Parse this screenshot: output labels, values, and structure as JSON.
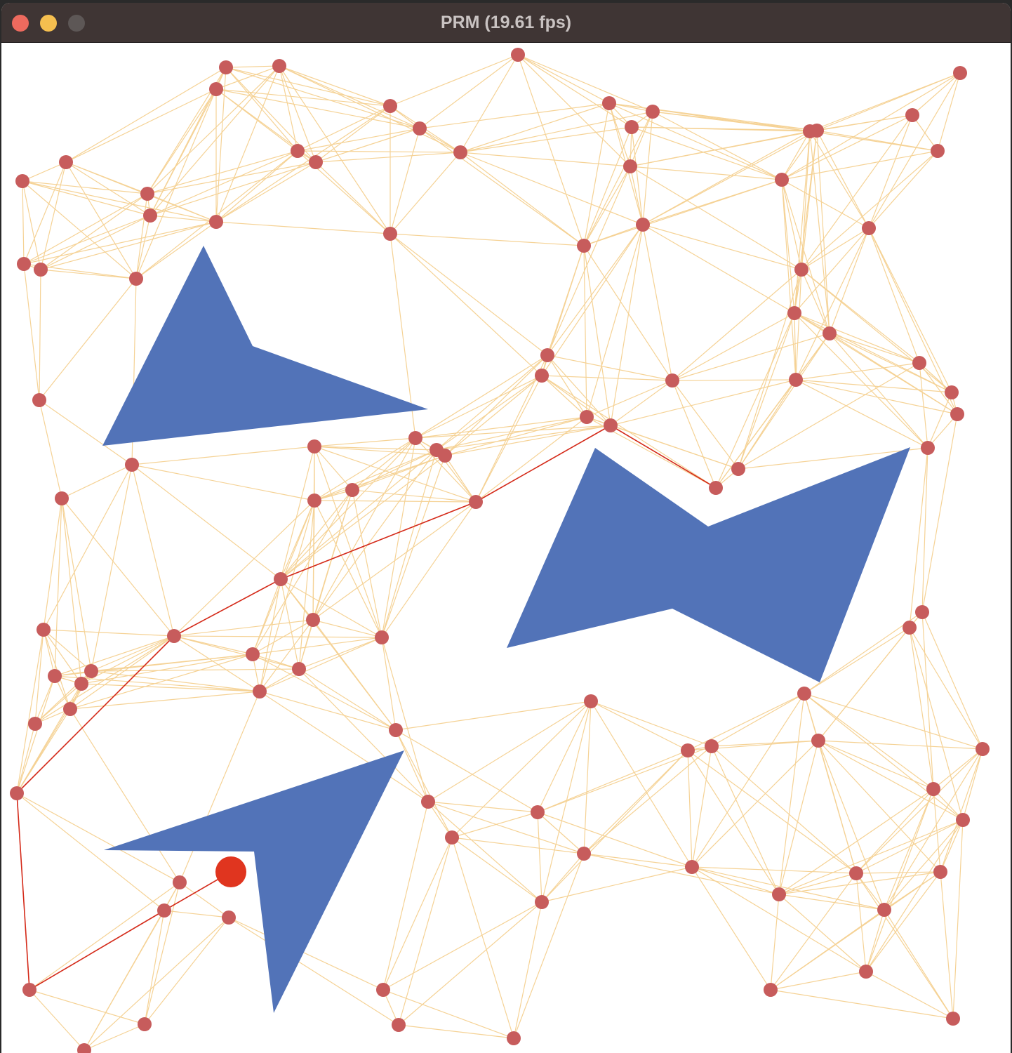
{
  "window": {
    "title": "PRM (19.61 fps)"
  },
  "colors": {
    "obstacle": "#5273b8",
    "edge": "#f5d295",
    "node": "#c75c5c",
    "path": "#d42a1a",
    "agent": "#e0351f",
    "background": "#ffffff"
  },
  "icons": {
    "close": "close-traffic-light-icon",
    "minimize": "minimize-traffic-light-icon",
    "zoom": "zoom-traffic-light-icon"
  }
}
